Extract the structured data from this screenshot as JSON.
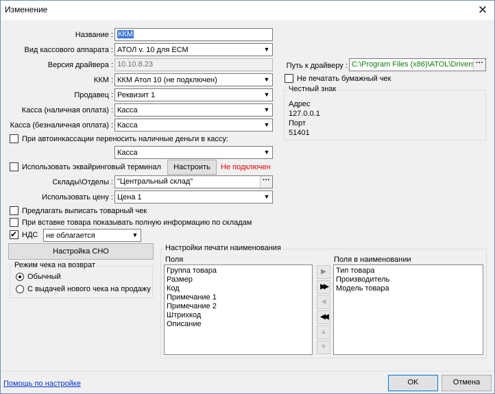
{
  "window": {
    "title": "Изменение",
    "close": "✕"
  },
  "form": {
    "name": {
      "label": "Название :",
      "value": "ККМ"
    },
    "device_type": {
      "label": "Вид кассового аппарата :",
      "value": "АТОЛ v. 10 для ЕСМ"
    },
    "driver_version": {
      "label": "Версия драйвера :",
      "value": "10.10.8.23"
    },
    "kkm": {
      "label": "ККМ :",
      "value": "ККМ Атол 10 (не подключен)"
    },
    "seller": {
      "label": "Продавец :",
      "value": "Реквизит 1"
    },
    "cash_register": {
      "label": "Касса (наличная оплата) :",
      "value": "Касса"
    },
    "cashless_register": {
      "label": "Касса (безналичная оплата) :",
      "value": "Касса"
    },
    "auto_collection": {
      "label": "При автоинкассации переносить наличные деньги в кассу:",
      "checked": false
    },
    "auto_collection_register": {
      "value": "Касса"
    },
    "acquiring": {
      "label": "Использовать эквайринговый терминал",
      "checked": false,
      "button": "Настроить",
      "status": "Не подключен"
    },
    "warehouses": {
      "label": "Склады\\Отделы :",
      "value": "\"Центральный склад\""
    },
    "price": {
      "label": "Использовать цену :",
      "value": "Цена 1"
    },
    "offer_receipt": {
      "label": "Предлагать выписать товарный чек",
      "checked": false
    },
    "full_stock_info": {
      "label": "При вставке товара показывать полную информацию по складам",
      "checked": false
    },
    "vat": {
      "label": "НДС",
      "checked": true,
      "value": "не облагается"
    },
    "sno_button": "Настройка СНО"
  },
  "driver_path": {
    "label": "Путь к драйверу :",
    "value": "C:\\Program Files (x86)\\ATOL\\Drivers"
  },
  "no_paper_receipt": {
    "label": "Не печатать бумажный чек",
    "checked": false
  },
  "honest_sign": {
    "legend": "Честный знак",
    "address_label": "Адрес",
    "address": "127.0.0.1",
    "port_label": "Порт",
    "port": "51401"
  },
  "return_mode": {
    "legend": "Режим чека на возврат",
    "options": [
      "Обычный",
      "С выдачей нового чека на продажу"
    ],
    "selected": 0
  },
  "print_settings": {
    "legend": "Настройки печати наименования",
    "fields_label": "Поля",
    "name_fields_label": "Поля в наименовании",
    "fields": [
      "Группа товара",
      "Размер",
      "Код",
      "Примечание 1",
      "Примечание 2",
      "Штрихкод",
      "Описание"
    ],
    "name_fields": [
      "Тип товара",
      "Производитель",
      "Модель товара"
    ],
    "buttons": {
      "move_right": "▶",
      "move_all_right": "▶▶",
      "move_left": "◀",
      "move_all_left": "◀◀",
      "up": "▲",
      "down": "▼"
    }
  },
  "footer": {
    "help_link": "Помощь по настройке",
    "ok": "OK",
    "cancel": "Отмена"
  }
}
